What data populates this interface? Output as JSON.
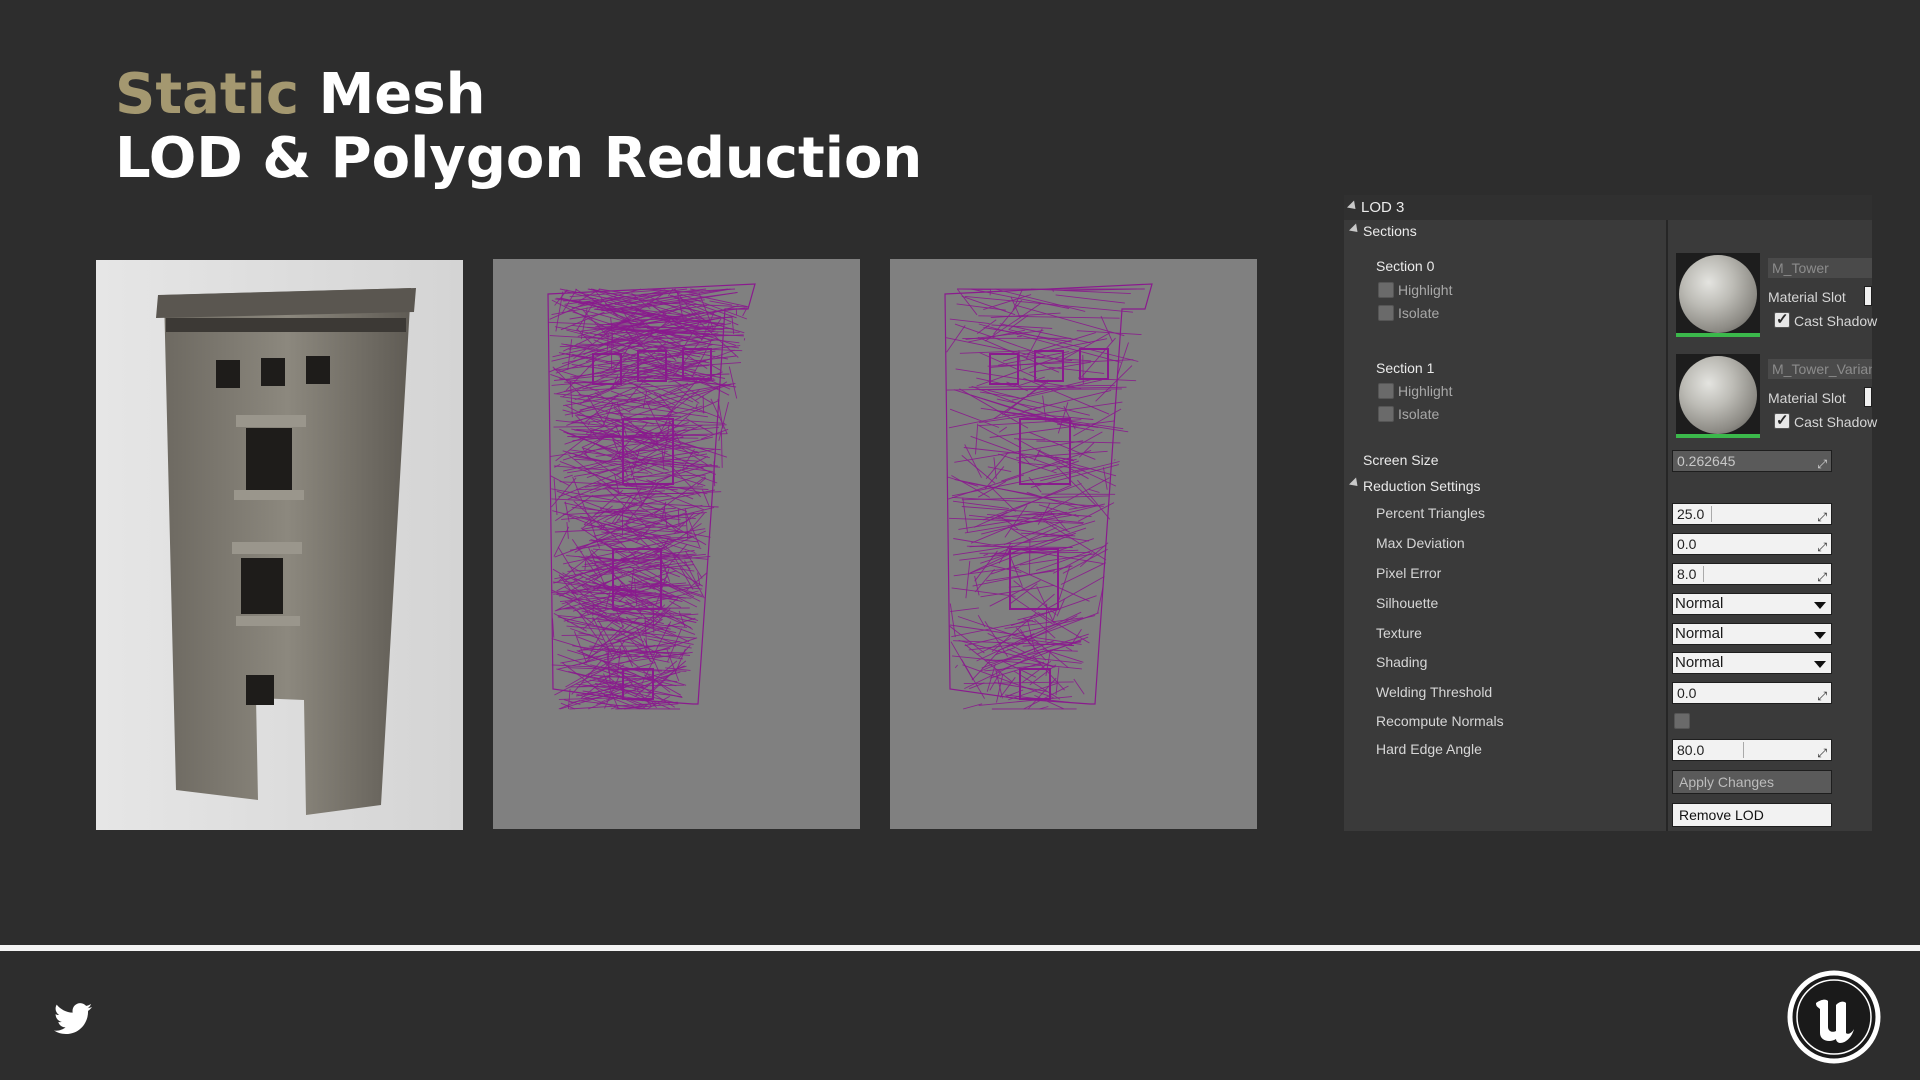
{
  "title": {
    "accent": "Static",
    "rest": "Mesh",
    "line2": "LOD & Polygon Reduction"
  },
  "details": {
    "lod_header": "LOD 3",
    "sections_header": "Sections",
    "sections": [
      {
        "label": "Section 0",
        "highlight": "Highlight",
        "isolate": "Isolate",
        "material": "M_Tower",
        "material_slot": "Material Slot",
        "cast_shadow": "Cast Shadow"
      },
      {
        "label": "Section 1",
        "highlight": "Highlight",
        "isolate": "Isolate",
        "material": "M_Tower_Variant",
        "material_slot": "Material Slot",
        "cast_shadow": "Cast Shadow"
      }
    ],
    "screen_size": {
      "label": "Screen Size",
      "value": "0.262645"
    },
    "reduction_header": "Reduction Settings",
    "percent_triangles": {
      "label": "Percent Triangles",
      "value": "25.0"
    },
    "max_deviation": {
      "label": "Max Deviation",
      "value": "0.0"
    },
    "pixel_error": {
      "label": "Pixel Error",
      "value": "8.0"
    },
    "silhouette": {
      "label": "Silhouette",
      "value": "Normal"
    },
    "texture": {
      "label": "Texture",
      "value": "Normal"
    },
    "shading": {
      "label": "Shading",
      "value": "Normal"
    },
    "welding_threshold": {
      "label": "Welding Threshold",
      "value": "0.0"
    },
    "recompute_normals": {
      "label": "Recompute Normals"
    },
    "hard_edge_angle": {
      "label": "Hard Edge Angle",
      "value": "80.0"
    },
    "apply_button": "Apply Changes",
    "remove_button": "Remove LOD"
  },
  "icons": {
    "social": "twitter-icon",
    "brand": "unreal-engine-logo"
  },
  "colors": {
    "accent": "#a49870",
    "wireframe": "#8a1a8e",
    "background": "#2d2d2d"
  }
}
